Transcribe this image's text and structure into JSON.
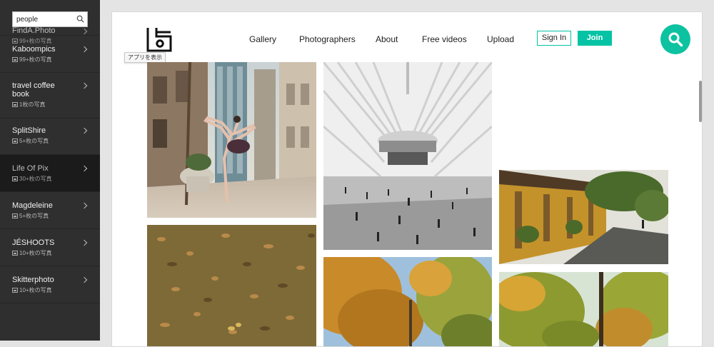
{
  "sidebar": {
    "search": {
      "value": "people",
      "placeholder": ""
    },
    "items": [
      {
        "name": "FindA.Photo",
        "count": "99+枚の写真"
      },
      {
        "name": "Kaboompics",
        "count": "99+枚の写真"
      },
      {
        "name": "travel coffee book",
        "count": "1枚の写真"
      },
      {
        "name": "SplitShire",
        "count": "5+枚の写真"
      },
      {
        "name": "Life Of Pix",
        "count": "30+枚の写真"
      },
      {
        "name": "Magdeleine",
        "count": "5+枚の写真"
      },
      {
        "name": "JÉSHOOTS",
        "count": "10+枚の写真"
      },
      {
        "name": "Skitterphoto",
        "count": "10+枚の写真"
      }
    ]
  },
  "header": {
    "tooltip": "アプリを表示",
    "nav": [
      "Gallery",
      "Photographers",
      "About",
      "Free videos",
      "Upload"
    ],
    "signin_label": "Sign In",
    "join_label": "Join"
  },
  "icons": {
    "search": "search-icon",
    "logo": "logo-icon",
    "chevron": "chevron-right-icon",
    "image": "image-icon"
  },
  "colors": {
    "accent": "#0dc2a0",
    "sidebar_bg": "#2f2f2f",
    "sidebar_selected": "#1b1b1b"
  },
  "grid": {
    "photos": [
      "ballet-dancer-street",
      "autumn-leaves-grass",
      "oculus-station-interior",
      "autumn-trees-sky",
      "yellow-houses-street",
      "autumn-tree-foliage"
    ]
  }
}
